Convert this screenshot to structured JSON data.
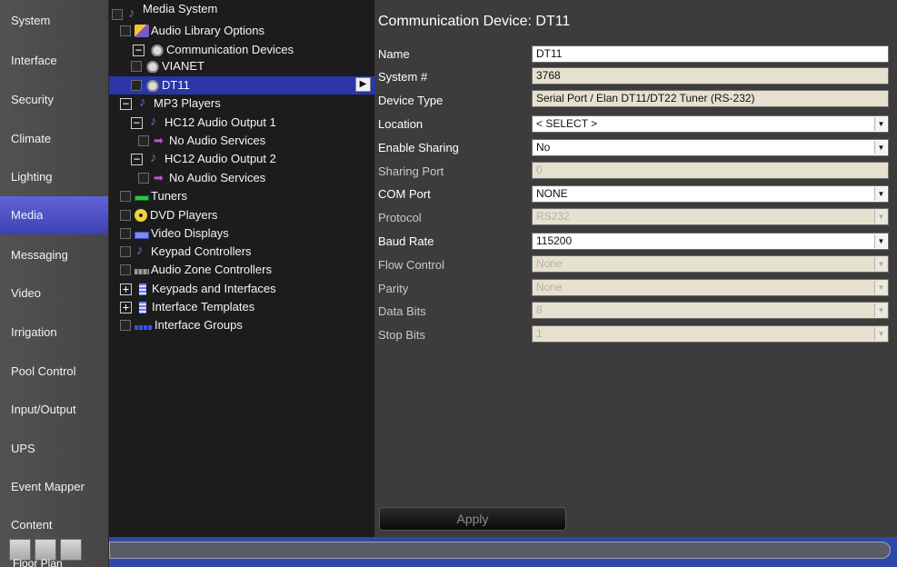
{
  "nav": {
    "items": [
      "System",
      "Interface",
      "Security",
      "Climate",
      "Lighting",
      "Media",
      "Messaging",
      "Video",
      "Irrigation",
      "Pool Control",
      "Input/Output",
      "UPS",
      "Event Mapper",
      "Content"
    ],
    "active": "Media",
    "floor_plan_label": "Floor Plan"
  },
  "tree": {
    "media_system": "Media System",
    "audio_library_options": "Audio Library Options",
    "communication_devices": "Communication Devices",
    "vianet": "VIANET",
    "dt11": "DT11",
    "mp3_players": "MP3 Players",
    "hc12_output_1": "HC12  Audio Output 1",
    "no_audio_services_1": "No Audio Services",
    "hc12_output_2": "HC12 Audio Output 2",
    "no_audio_services_2": "No Audio Services",
    "tuners": "Tuners",
    "dvd_players": "DVD Players",
    "video_displays": "Video Displays",
    "keypad_controllers": "Keypad Controllers",
    "audio_zone_controllers": "Audio Zone Controllers",
    "keypads_and_interfaces": "Keypads and Interfaces",
    "interface_templates": "Interface Templates",
    "interface_groups": "Interface Groups"
  },
  "panel": {
    "title": "Communication Device: DT11",
    "fields": {
      "name": {
        "label": "Name",
        "value": "DT11"
      },
      "system_num": {
        "label": "System #",
        "value": "3768"
      },
      "device_type": {
        "label": "Device Type",
        "value": "Serial Port / Elan DT11/DT22 Tuner (RS-232)"
      },
      "location": {
        "label": "Location",
        "value": "< SELECT >"
      },
      "enable_sharing": {
        "label": "Enable Sharing",
        "value": "No"
      },
      "sharing_port": {
        "label": "Sharing Port",
        "value": "0"
      },
      "com_port": {
        "label": "COM Port",
        "value": "NONE"
      },
      "protocol": {
        "label": "Protocol",
        "value": "RS232"
      },
      "baud_rate": {
        "label": "Baud Rate",
        "value": "115200"
      },
      "flow_control": {
        "label": "Flow Control",
        "value": "None"
      },
      "parity": {
        "label": "Parity",
        "value": "None"
      },
      "data_bits": {
        "label": "Data Bits",
        "value": "8"
      },
      "stop_bits": {
        "label": "Stop Bits",
        "value": "1"
      }
    },
    "apply_label": "Apply"
  },
  "icons": {
    "tree_expand": "minus-box",
    "tree_collapsed": "plus-box",
    "dropdown": "triangle-down",
    "selection_marker": "play-arrow"
  },
  "colors": {
    "active_nav": "#4f53c9",
    "selected_row": "#2935a8",
    "readonly_field": "#e6e1cf"
  }
}
